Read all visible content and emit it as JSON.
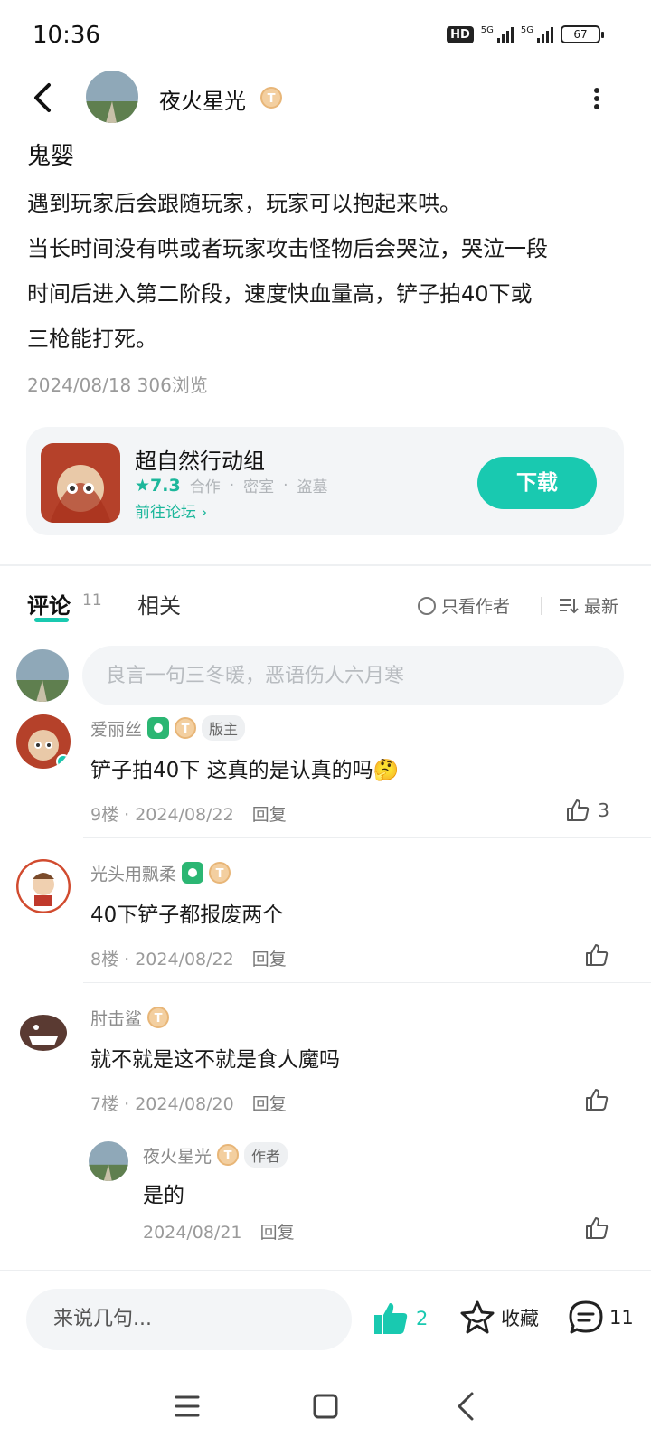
{
  "status_bar": {
    "time": "10:36",
    "hd": "HD",
    "signal1": "5G",
    "signal2": "5G",
    "battery": "67"
  },
  "header": {
    "author": "夜火星光",
    "level": "T"
  },
  "post": {
    "title": "鬼婴",
    "body_lines": [
      "遇到玩家后会跟随玩家，玩家可以抱起来哄。",
      "当长时间没有哄或者玩家攻击怪物后会哭泣，哭泣一段",
      "时间后进入第二阶段，速度快血量高，铲子拍40下或",
      "三枪能打死。"
    ],
    "meta": "2024/08/18  306浏览"
  },
  "game_card": {
    "name": "超自然行动组",
    "rating": "7.3",
    "tags": [
      "合作",
      "密室",
      "盗墓"
    ],
    "forum_link": "前往论坛",
    "download": "下载"
  },
  "tabs": {
    "comments": "评论",
    "comment_count": "11",
    "related": "相关",
    "only_author": "只看作者",
    "sort": "最新"
  },
  "compose": {
    "placeholder": "良言一句三冬暖，恶语伤人六月寒"
  },
  "comments": [
    {
      "name": "爱丽丝",
      "badge": "版主",
      "text": "铲子拍40下 这真的是认真的吗🤔",
      "floor": "9楼",
      "date": "2024/08/22",
      "reply": "回复",
      "likes": "3"
    },
    {
      "name": "光头用飘柔",
      "text": "40下铲子都报废两个",
      "floor": "8楼",
      "date": "2024/08/22",
      "reply": "回复"
    },
    {
      "name": "肘击鲨",
      "text": "就不就是这不就是食人魔吗",
      "floor": "7楼",
      "date": "2024/08/20",
      "reply": "回复"
    }
  ],
  "sub_reply": {
    "name": "夜火星光",
    "badge": "作者",
    "text": "是的",
    "date": "2024/08/21",
    "reply": "回复"
  },
  "bottom_bar": {
    "say": "来说几句...",
    "likes": "2",
    "favorite": "收藏",
    "comments": "11"
  },
  "colors": {
    "accent": "#19c9b0"
  }
}
